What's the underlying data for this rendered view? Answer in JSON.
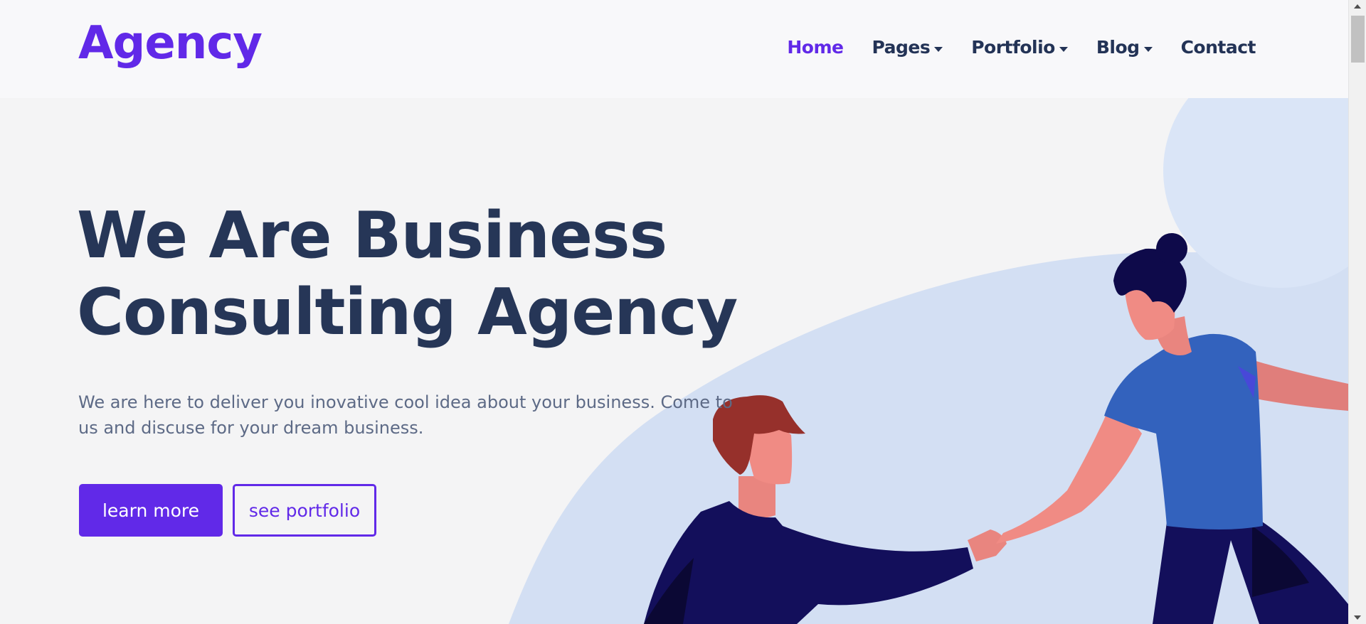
{
  "brand": {
    "logo": "Agency",
    "accent": "#6129e8",
    "heading_color": "#263657"
  },
  "nav": {
    "items": [
      {
        "label": "Home",
        "active": true,
        "dropdown": false
      },
      {
        "label": "Pages",
        "active": false,
        "dropdown": true
      },
      {
        "label": "Portfolio",
        "active": false,
        "dropdown": true
      },
      {
        "label": "Blog",
        "active": false,
        "dropdown": true
      },
      {
        "label": "Contact",
        "active": false,
        "dropdown": false
      }
    ]
  },
  "hero": {
    "title_line1": "We Are Business",
    "title_line2": "Consulting Agency",
    "text": "We are here to deliver you inovative cool idea about your business. Come to us and discuse for your dream business.",
    "primary_button": "learn more",
    "secondary_button": "see portfolio"
  },
  "illustration": {
    "icon": "handshake-illustration"
  }
}
